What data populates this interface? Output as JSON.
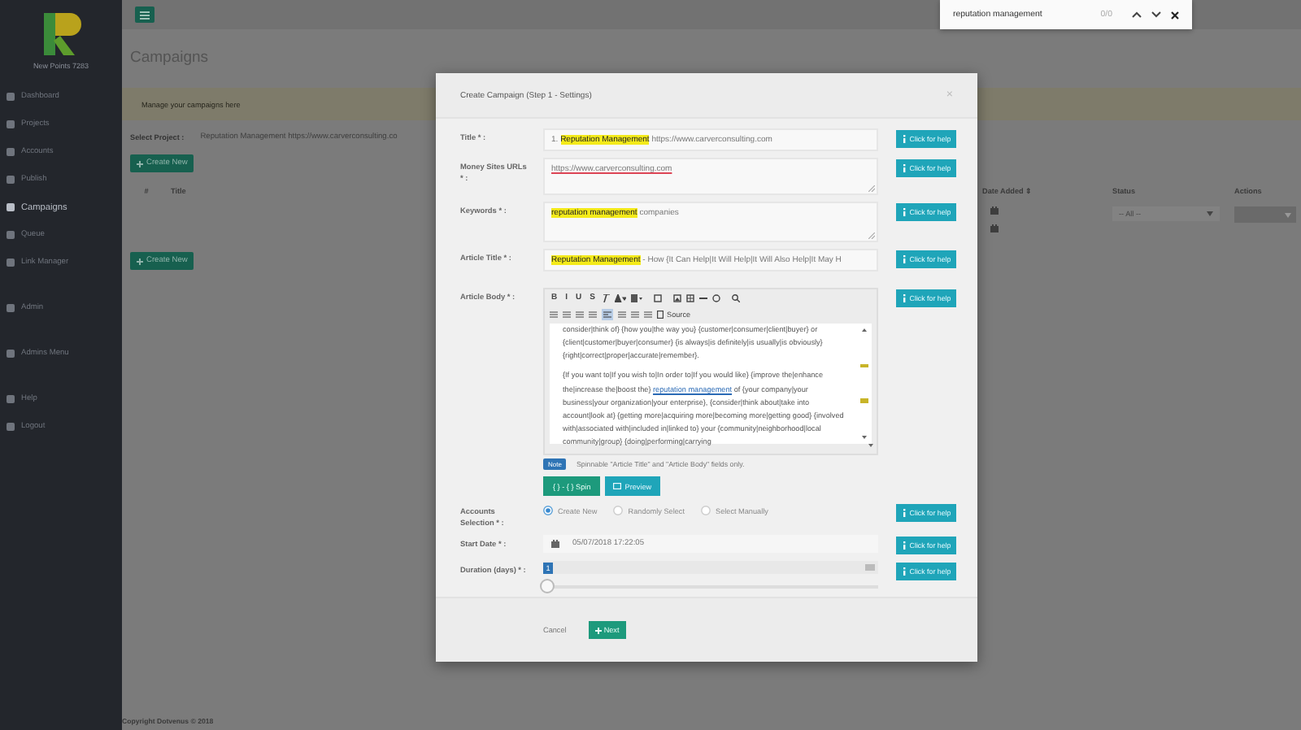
{
  "sidebar": {
    "brand": "New Points 7283",
    "groups": [
      [
        {
          "label": "Dashboard",
          "selected": false
        },
        {
          "label": "Projects",
          "selected": false
        },
        {
          "label": "Accounts",
          "selected": false
        },
        {
          "label": "Publish",
          "selected": false
        },
        {
          "label": "Campaigns",
          "selected": true
        },
        {
          "label": "Queue",
          "selected": false
        },
        {
          "label": "Link Manager",
          "selected": false
        }
      ],
      [
        {
          "label": "Admin",
          "selected": false
        }
      ],
      [
        {
          "label": "Admins Menu",
          "selected": false
        }
      ],
      [
        {
          "label": "Help",
          "selected": false
        },
        {
          "label": "Logout",
          "selected": false
        }
      ]
    ]
  },
  "page": {
    "title": "Campaigns",
    "notice": "Manage your campaigns here",
    "select_project": {
      "label": "Select Project :",
      "value": "Reputation Management https://www.carverconsulting.co"
    },
    "create_button": "Create New",
    "table": {
      "columns": [
        {
          "kind": "text",
          "label": "#"
        },
        {
          "kind": "text",
          "label": "Title"
        },
        {
          "kind": "text",
          "label": "Date Added ⇕"
        },
        {
          "kind": "text",
          "label": "Status"
        },
        {
          "kind": "text",
          "label": "Actions"
        }
      ],
      "status_filter": "-- All --"
    },
    "create_button_bottom": "Create New",
    "footer": "Copyright Dotvenus © 2018"
  },
  "find_bar": {
    "query": "reputation management",
    "count": "0/0"
  },
  "modal": {
    "title": "Create Campaign (Step 1 - Settings)",
    "close": "×",
    "fields": [
      {
        "kind": "text",
        "label": "Title * :",
        "help": "Click for help",
        "segments": [
          {
            "text": "1. ",
            "highlighted": false
          },
          {
            "text": "Reputation Management",
            "highlighted": true
          },
          {
            "text": " https://www.carverconsulting.com",
            "highlighted": false
          }
        ]
      },
      {
        "kind": "textarea",
        "label": "Money Sites URLs * :",
        "help": "Click for help",
        "segments": [
          {
            "text": "https://www.carverconsulting.com",
            "highlighted": false
          }
        ]
      },
      {
        "kind": "textarea",
        "label": "Keywords * :",
        "help": "Click for help",
        "segments": [
          {
            "text": "reputation management",
            "highlighted": true
          },
          {
            "text": " companies",
            "highlighted": false
          }
        ]
      },
      {
        "kind": "text",
        "label": "Article Title * :",
        "help": "Click for help",
        "segments": [
          {
            "text": "Reputation Management",
            "highlighted": true
          },
          {
            "text": " - How {It Can Help|It Will Help|It Will Also Help|It May H",
            "highlighted": false
          }
        ]
      },
      {
        "kind": "editor",
        "label": "Article Body * :",
        "help": "Click for help",
        "toolbar": [
          [
            "B",
            "I",
            "U",
            "S"
          ],
          [
            "Source"
          ]
        ],
        "paragraphs": [
          [
            {
              "kind": "text",
              "text": "consider|think of} {how you|the way you} {customer|consumer|client|buyer} or {client|customer|buyer|consumer} {is always|is definitely|is usually|is obviously} {right|correct|proper|accurate|remember}."
            }
          ],
          [
            {
              "kind": "text",
              "text": "{If you want to|If you wish to|In order to|If you would like} {improve the|enhance the|increase the|boost the} "
            },
            {
              "kind": "link",
              "text": "reputation management"
            },
            {
              "kind": "text",
              "text": " of {your company|your business|your organization|your enterprise}, {consider|think about|take into account|look at} {getting more|acquiring more|becoming more|getting good} {involved with|associated with|included in|linked to} your {community|neighborhood|local community|group} {doing|performing|carrying"
            }
          ]
        ],
        "note_badge": "Note",
        "note": "Spinnable \"Article Title\" and \"Article Body\" fields only.",
        "spin_button": "{ } - { } Spin",
        "preview_button": "Preview"
      },
      {
        "kind": "radios",
        "label": "Accounts Selection * :",
        "help": "Click for help",
        "options": [
          {
            "label": "Create New",
            "selected": true
          },
          {
            "label": "Randomly Select",
            "selected": false
          },
          {
            "label": "Select Manually",
            "selected": false
          }
        ]
      },
      {
        "kind": "date",
        "label": "Start Date * :",
        "help": "Click for help",
        "value": "05/07/2018 17:22:05"
      },
      {
        "kind": "slider",
        "label": "Duration (days) * :",
        "help": "Click for help",
        "reading": "1",
        "level": 0
      }
    ],
    "cancel": "Cancel",
    "next": "Next"
  }
}
